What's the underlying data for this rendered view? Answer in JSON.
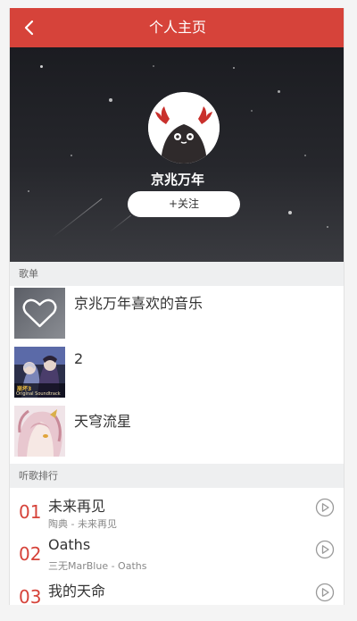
{
  "header": {
    "title": "个人主页",
    "accent_color": "#d6433a",
    "back_icon": "chevron-left-icon"
  },
  "profile": {
    "username": "京兆万年",
    "follow_label": "+关注"
  },
  "playlists": {
    "section_label": "歌单",
    "items": [
      {
        "name": "京兆万年喜欢的音乐",
        "cover": "heart-cover"
      },
      {
        "name": "2",
        "cover": "game-soundtrack-cover",
        "cover_caption_top": "崩坏3",
        "cover_caption_bottom": "Original Soundtrack"
      },
      {
        "name": "天穹流星",
        "cover": "anime-portrait-cover"
      }
    ]
  },
  "ranking": {
    "section_label": "听歌排行",
    "items": [
      {
        "rank": "01",
        "title": "未来再见",
        "subtitle": "陶典 - 未来再见"
      },
      {
        "rank": "02",
        "title": "Oaths",
        "subtitle": "三无MarBlue - Oaths"
      },
      {
        "rank": "03",
        "title": "我的天命",
        "subtitle": ""
      }
    ],
    "play_icon": "play-circle-icon"
  }
}
